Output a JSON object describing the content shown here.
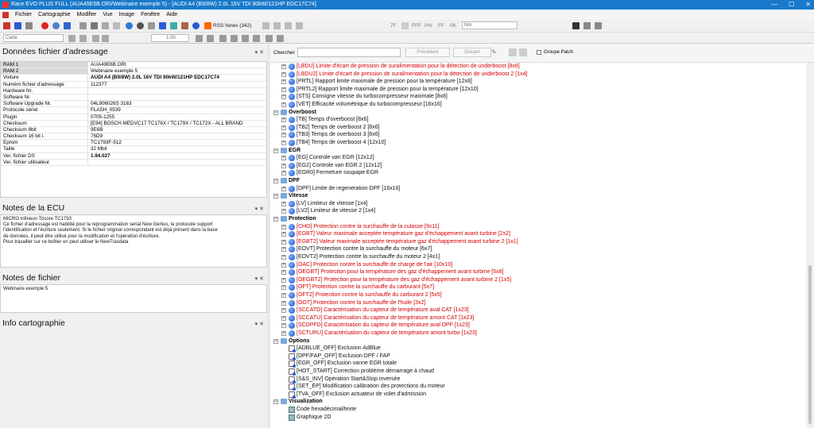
{
  "window": {
    "title": "Race EVO PLUS FULL (AUA49E6B.ORI/Webinaire exemple 5) - [AUDI A4 (B9/8W) 2.0L 16V TDI 90kW/121HP EDC17C74]"
  },
  "menu": [
    "Fichier",
    "Cartographie",
    "Modifier",
    "Vue",
    "Image",
    "Fenêtre",
    "Aide"
  ],
  "toolbar": {
    "rss_label": "RSS News (342)",
    "zoom_value": "1.00",
    "mode_value": "Carte",
    "unit_value": "Nm",
    "ff_label": "7F",
    "fff_label": "FFF",
    "pct_label": "0%"
  },
  "address_panel": {
    "title": "Données fichier d'adressage",
    "rows": [
      {
        "k": "RAM 1",
        "v": "AUA49E6B.ORI"
      },
      {
        "k": "RAM 2",
        "v": "Webinaire exemple 5"
      },
      {
        "k": "Voiture",
        "v": "AUDI A4 (B9/8W) 2.0L 16V TDI 90kW/121HP EDC17C74"
      },
      {
        "k": "Numéro fichier d'adressage",
        "v": "112377"
      },
      {
        "k": "Hardware Nr.",
        "v": ""
      },
      {
        "k": "Software Nr.",
        "v": ""
      },
      {
        "k": "Software Upgrade Nr.",
        "v": "04L906026S    3163"
      },
      {
        "k": "Protocole sériel",
        "v": "FLASH_0539"
      },
      {
        "k": "Plugin",
        "v": "0705-1255"
      },
      {
        "k": "Checksum",
        "v": "[E94] BOSCH MEDVC17 TC176X / TC179X / TC172X - ALL BRAND"
      },
      {
        "k": "Checksum 8bit",
        "v": "9E6B"
      },
      {
        "k": "Checksum 16 bit i.",
        "v": "76D9"
      },
      {
        "k": "Eprom",
        "v": "TC1793F-512"
      },
      {
        "k": "Taille",
        "v": "32 Mbit"
      },
      {
        "k": "Ver. fichier DS",
        "v": "1.94.027"
      },
      {
        "k": "Ver. fichier utilisateur",
        "v": ""
      }
    ]
  },
  "ecu_notes": {
    "title": "Notes de la ECU",
    "text": "MICRO Infineon Tricore TC1793\nCe fichier d'adressage est habilité pour la reprogrammation serial New Genius, le protocole support\nl'identification et l'écriture seulement. Si le fichier original correspondant est déjà présent dans la base\nde données, il peut être utilisé pour la modification et l'opération d'écriture.\nPour travailler sur ce boîtier on peut utiliser le NewTrasdata"
  },
  "file_notes": {
    "title": "Notes de fichier",
    "text": "Webinaire exemple 5"
  },
  "carto_info": {
    "title": "Info cartographie"
  },
  "search": {
    "label": "Chercher",
    "prev": "Précédent",
    "next": "Suivant",
    "group_patch": "Groupe Patch"
  },
  "tree": [
    {
      "t": "item",
      "c": "red",
      "d": 2,
      "label": "[LBDU] Limite d'écart de pression de suralimentation pour la détection de underboost [8x8]"
    },
    {
      "t": "item",
      "c": "red",
      "d": 2,
      "label": "[LBDU2] Limite d'écart de pression de suralimentation pour la détection de underboost 2 [1x4]"
    },
    {
      "t": "item",
      "c": "blk",
      "d": 2,
      "label": "[PRTL] Rapport limite maximale de pression pour la  température [12x8]"
    },
    {
      "t": "item",
      "c": "blk",
      "d": 2,
      "label": "[PRTL2] Rapport limite maximale de pression pour la  température [12x10]"
    },
    {
      "t": "item",
      "c": "blk",
      "d": 2,
      "label": "[STS] Consigne vitesse du turbocompresseur maximale [8x8]"
    },
    {
      "t": "item",
      "c": "blk",
      "d": 2,
      "label": "[VET] Efficacité volumétrique du turbocompresseur [16x16]"
    },
    {
      "t": "cat",
      "d": 1,
      "label": "Overboost"
    },
    {
      "t": "item",
      "c": "blk",
      "d": 2,
      "label": "[TB] Temps d'overboost [8x6]"
    },
    {
      "t": "item",
      "c": "blk",
      "d": 2,
      "label": "[TB2] Temps de overboost 2 [8x6]"
    },
    {
      "t": "item",
      "c": "blk",
      "d": 2,
      "label": "[TB3] Temps de overboost 3 [8x6]"
    },
    {
      "t": "item",
      "c": "blk",
      "d": 2,
      "label": "[TB4] Temps de overboost 4 [12x10]"
    },
    {
      "t": "cat",
      "d": 1,
      "label": "EGR"
    },
    {
      "t": "item",
      "c": "blk",
      "d": 2,
      "label": "[EG] Controle van EGR [12x12]"
    },
    {
      "t": "item",
      "c": "blk",
      "d": 2,
      "label": "[EG2] Controle van EGR 2 [12x12]"
    },
    {
      "t": "item",
      "c": "blk",
      "d": 2,
      "label": "[EGR0] Fermeture soupape EGR"
    },
    {
      "t": "cat",
      "d": 1,
      "label": "DPF"
    },
    {
      "t": "item",
      "c": "blk",
      "d": 2,
      "label": "[DPF] Limite de regeneration DPF [16x16]"
    },
    {
      "t": "cat",
      "d": 1,
      "label": "Vitesse"
    },
    {
      "t": "item",
      "c": "blk",
      "d": 2,
      "label": "[LV] Limiteur de vitesse [1x4]"
    },
    {
      "t": "item",
      "c": "blk",
      "d": 2,
      "label": "[LV2] Limiteur de vitesse 2 [1x4]"
    },
    {
      "t": "cat",
      "d": 1,
      "label": "Protection"
    },
    {
      "t": "item",
      "c": "red",
      "d": 2,
      "label": "[CHO] Protection contre la surchauffe de la culasse [9x11]"
    },
    {
      "t": "item",
      "c": "red",
      "d": 2,
      "label": "[EGBT] Valeur maximale acceptée température gaz d'échappement avant turbine [2x2]"
    },
    {
      "t": "item",
      "c": "red",
      "d": 2,
      "label": "[EGBT2] Valeur maximale acceptée température gaz d'échappement avant turbine 2 [1x1]"
    },
    {
      "t": "item",
      "c": "blk",
      "d": 2,
      "label": "[EOVT] Protection contre la surchauffe du moteur [6x7]"
    },
    {
      "t": "item",
      "c": "blk",
      "d": 2,
      "label": "[EOVT2] Protection contre la surchauffe du moteur 2 [4x1]"
    },
    {
      "t": "item",
      "c": "red",
      "d": 2,
      "label": "[OAC] Protection contre la surchauffe de charge de l'air [10x10]"
    },
    {
      "t": "item",
      "c": "red",
      "d": 2,
      "label": "[OEGBT] Protection pour la température des gaz d'échappement avant turbine [5x8]"
    },
    {
      "t": "item",
      "c": "red",
      "d": 2,
      "label": "[OEGBT2] Protection pour la température des gaz d'échappement avant turbine 2 [1x5]"
    },
    {
      "t": "item",
      "c": "red",
      "d": 2,
      "label": "[OFT] Protection contre la surchauffe du carburant [5x7]"
    },
    {
      "t": "item",
      "c": "red",
      "d": 2,
      "label": "[OFT2] Protection contre la surchauffe du carburant 2 [5x5]"
    },
    {
      "t": "item",
      "c": "red",
      "d": 2,
      "label": "[OOT] Protection contre la surchauffe de l'huile [3x2]"
    },
    {
      "t": "item",
      "c": "red",
      "d": 2,
      "label": "[SCCATD] Caractérisation du capteur de température aval CAT [1x23]"
    },
    {
      "t": "item",
      "c": "red",
      "d": 2,
      "label": "[SCCATU] Caractérisation du capteur de température amont CAT [1x23]"
    },
    {
      "t": "item",
      "c": "red",
      "d": 2,
      "label": "[SCDPFD] Caractérisation du capteur de température aval DPF [1x23]"
    },
    {
      "t": "item",
      "c": "red",
      "d": 2,
      "label": "[SCTURU] Caractérisation du capteur de température amont turbo [1x23]"
    },
    {
      "t": "cat",
      "d": 1,
      "label": "Options"
    },
    {
      "t": "opt",
      "c": "blk",
      "d": 2,
      "label": "[ADBLUE_OFF] Exclusion AdBlue"
    },
    {
      "t": "opt",
      "c": "blk",
      "d": 2,
      "label": "[DPF/FAP_OFF] Exclusion DPF / FAP"
    },
    {
      "t": "opt",
      "c": "blk",
      "d": 2,
      "label": "[EGR_OFF] Exclusion vanne EGR totale"
    },
    {
      "t": "opt",
      "c": "blk",
      "d": 2,
      "label": "[HOT_START] Correction problème démarrage à chaud"
    },
    {
      "t": "opt",
      "c": "blk",
      "d": 2,
      "label": "[S&S_INV] Opération Start&Stop inversée"
    },
    {
      "t": "opt",
      "c": "blk",
      "d": 2,
      "label": "[SET_EP] Modification calibration des protections du moteur"
    },
    {
      "t": "opt",
      "c": "blk",
      "d": 2,
      "label": "[TVA_OFF] Exclusion actuateur de volet d'admission"
    },
    {
      "t": "cat",
      "d": 1,
      "label": "Visualization"
    },
    {
      "t": "vis",
      "c": "blk",
      "d": 2,
      "label": "Code hexadécimal/texte"
    },
    {
      "t": "vis",
      "c": "blk",
      "d": 2,
      "label": "Graphique 2D"
    }
  ]
}
